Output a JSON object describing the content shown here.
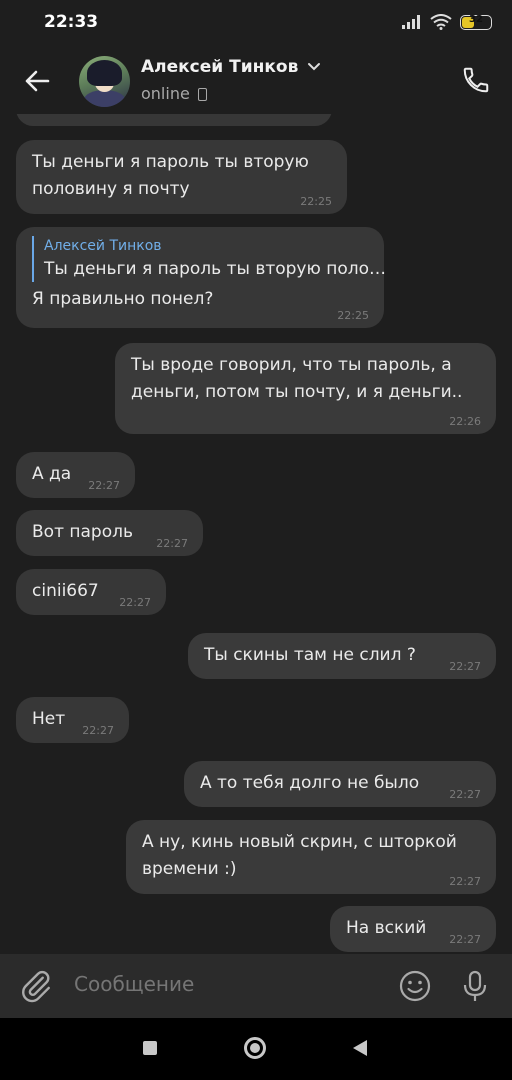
{
  "status_bar": {
    "time": "22:33",
    "battery": "32"
  },
  "header": {
    "contact_name": "Алексей Тинков",
    "status": "online"
  },
  "messages": [
    {
      "direction": "in",
      "text": "Ты деньги я пароль ты вторую\nполовину я почту",
      "time": "22:25"
    },
    {
      "direction": "in",
      "reply_author": "Алексей Тинков",
      "reply_text": "Ты деньги я пароль ты вторую поло…",
      "text": "Я правильно понел?",
      "time": "22:25"
    },
    {
      "direction": "out",
      "text": "Ты вроде говорил, что ты пароль, а\nденьги, потом ты почту, и я деньги..",
      "time": "22:26"
    },
    {
      "direction": "in",
      "text": "А да",
      "time": "22:27"
    },
    {
      "direction": "in",
      "text": "Вот пароль",
      "time": "22:27"
    },
    {
      "direction": "in",
      "text": "cinii667",
      "time": "22:27"
    },
    {
      "direction": "out",
      "text": "Ты скины там не слил ?",
      "time": "22:27"
    },
    {
      "direction": "in",
      "text": "Нет",
      "time": "22:27"
    },
    {
      "direction": "out",
      "text": "А то тебя долго не было",
      "time": "22:27"
    },
    {
      "direction": "out",
      "text": "А ну, кинь новый скрин, с шторкой\nвремени :)",
      "time": "22:27"
    },
    {
      "direction": "out",
      "text": "На вский",
      "time": "22:27"
    }
  ],
  "composer": {
    "placeholder": "Сообщение"
  },
  "icons": {
    "back": "arrow-left-icon",
    "call": "phone-icon",
    "attach": "paperclip-icon",
    "emoji": "smiley-icon",
    "mic": "microphone-icon"
  },
  "colors": {
    "background": "#1e1e1e",
    "bubble": "#373737",
    "reply_accent": "#71aee8"
  }
}
